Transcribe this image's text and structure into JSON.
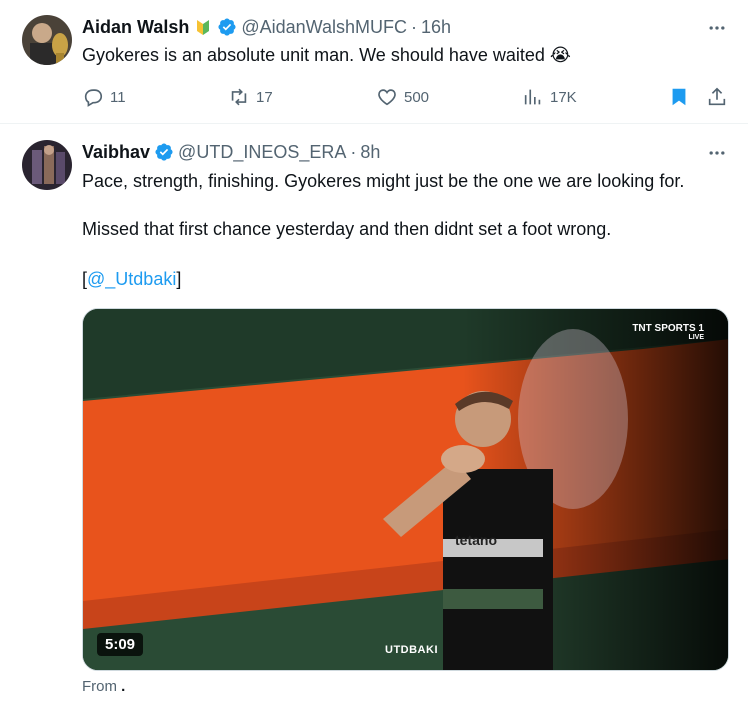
{
  "tweets": [
    {
      "name": "Aidan Walsh",
      "badge_icon": "beginner-badge-icon",
      "handle": "@AidanWalshMUFC",
      "separator": "·",
      "time": "16h",
      "text": "Gyokeres is an absolute unit man. We should have waited 😭",
      "actions": {
        "replies": "11",
        "reposts": "17",
        "likes": "500",
        "views": "17K"
      }
    },
    {
      "name": "Vaibhav",
      "handle": "@UTD_INEOS_ERA",
      "separator": "·",
      "time": "8h",
      "para1": "Pace, strength, finishing. Gyokeres might just be the one we are looking for.",
      "para2": "Missed that first chance yesterday and then didnt set a foot wrong.",
      "para3_open": "[",
      "para3_mention": "@_Utdbaki",
      "para3_close": "]",
      "video": {
        "duration": "5:09",
        "watermark": "UTDBAKI",
        "broadcaster": "TNT SPORTS 1",
        "broadcaster_sub": "LIVE",
        "shirt_text": "tetano"
      },
      "from_label": "From",
      "from_value": "."
    }
  ],
  "colors": {
    "accent": "#1d9bf0",
    "muted": "#536471",
    "bookmark": "#1d9bf0",
    "board_orange": "#e8531c"
  }
}
